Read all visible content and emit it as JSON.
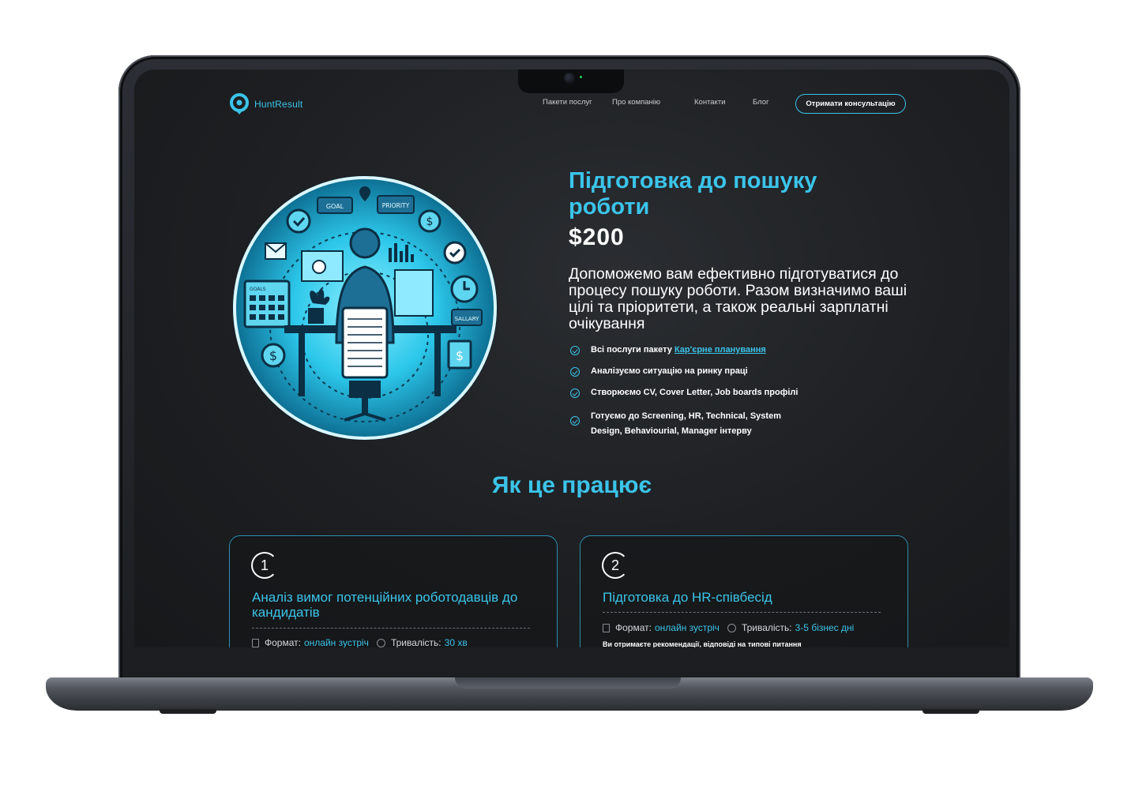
{
  "site": {
    "logo_text": "HuntResult",
    "nav": [
      {
        "label": "Пакети послуг"
      },
      {
        "label": "Про компанію"
      },
      {
        "label": "Контакти"
      },
      {
        "label": "Блог"
      }
    ],
    "cta_label": "Отримати консультацію"
  },
  "hero": {
    "title": "Підготовка до пошуку роботи",
    "price": "$200",
    "description": "Допоможемо вам ефективно підготуватися до процесу пошуку роботи. Разом визначимо ваші цілі та пріоритети, а також реальні зарплатні очікування",
    "features": [
      {
        "text": "Всі послуги пакету ",
        "link": "Кар'єрне планування"
      },
      {
        "text": "Аналізуємо ситуацію на ринку праці"
      },
      {
        "text": "Створюємо CV, Cover Letter, Job boards профілі"
      },
      {
        "text": "Готуємо до Screening, HR, Technical, System Design, Behaviourial, Manager інтерву"
      }
    ],
    "illustration": {
      "labels": {
        "goal": "GOAL",
        "priority": "PRIORITY",
        "salary": "SALLARY",
        "goals": "GOALS"
      }
    }
  },
  "how_it_works": {
    "title": "Як це працює",
    "cards": [
      {
        "number": "1",
        "title": "Аналіз вимог потенційних роботодавців до кандидатів",
        "format_label": "Формат:",
        "format_value": "онлайн зустріч",
        "duration_label": "Тривалість:",
        "duration_value": "30 хв",
        "text": ""
      },
      {
        "number": "2",
        "title": "Підготовка до HR-співбесід",
        "format_label": "Формат:",
        "format_value": "онлайн зустріч",
        "duration_label": "Тривалість:",
        "duration_value": "3-5 бізнес дні",
        "text": "Ви отримаєте рекомендації, відповіді на типові питання"
      }
    ]
  },
  "colors": {
    "accent": "#3bc4ea",
    "background": "#1d1f22",
    "text": "#ffffff"
  }
}
